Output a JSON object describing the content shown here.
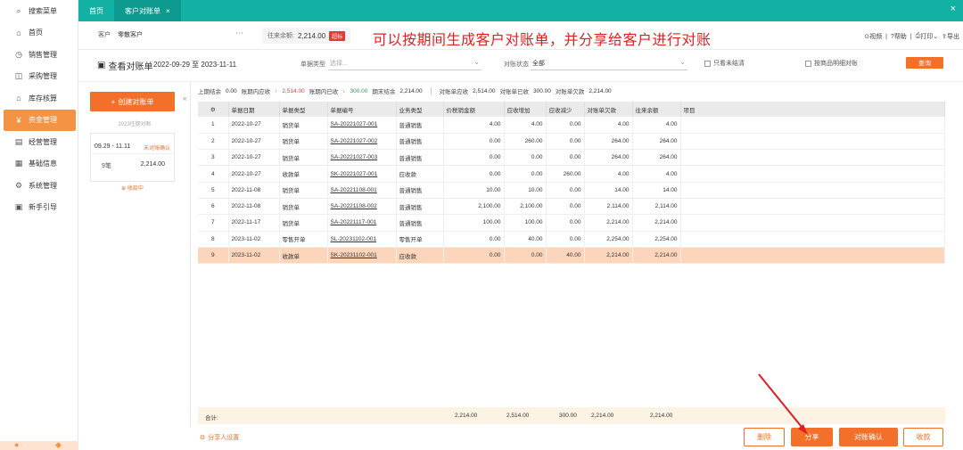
{
  "sidebar": {
    "items": [
      {
        "label": "搜索菜单",
        "icon": "search-icon"
      },
      {
        "label": "首页",
        "icon": "home-icon"
      },
      {
        "label": "销售管理",
        "icon": "sales-icon"
      },
      {
        "label": "采购管理",
        "icon": "purchase-icon"
      },
      {
        "label": "库存核算",
        "icon": "warehouse-icon"
      },
      {
        "label": "资金管理",
        "icon": "funds-icon",
        "active": true
      },
      {
        "label": "经营管理",
        "icon": "business-icon"
      },
      {
        "label": "基础信息",
        "icon": "info-icon"
      },
      {
        "label": "系统管理",
        "icon": "settings-icon"
      },
      {
        "label": "新手引导",
        "icon": "guide-icon"
      }
    ]
  },
  "tabs": [
    {
      "label": "首页"
    },
    {
      "label": "客户对账单",
      "active": true
    }
  ],
  "customer": {
    "label": "客户",
    "name": "零散客户",
    "balance_label": "往来余额:",
    "balance": "2,214.00",
    "balance_badge": "超标"
  },
  "annotation": "可以按期间生成客户对账单，并分享给客户进行对账",
  "toolbar": {
    "video": "视频",
    "help": "帮助",
    "print": "打印",
    "export": "导出"
  },
  "filter": {
    "title": "查看对账单",
    "date_range": "2022-09-29 至 2023-11-11",
    "doc_type_label": "单据类型",
    "doc_type_placeholder": "选择...",
    "status_label": "对账状态",
    "status_value": "全部",
    "only_unsettled": "只看未结清",
    "by_product": "按商品明细对账",
    "query": "查询"
  },
  "left_panel": {
    "create_label": "创建对账单",
    "subtitle": "2023往期对账",
    "card": {
      "period": "09.29 - 11.11",
      "status": "未对账确认",
      "count": "9笔",
      "amount": "2,214.00",
      "collapse": "收款中"
    }
  },
  "summary": {
    "prev_label": "上期结余",
    "prev_value": "0.00",
    "recv_label": "账期内应收",
    "recv_value": "2,514.00",
    "paid_label": "账期内已收",
    "paid_value": "300.00",
    "end_label": "期末结余",
    "end_value": "2,214.00",
    "bill_recv_label": "对账单应收",
    "bill_recv_value": "2,514.00",
    "bill_paid_label": "对账单已收",
    "bill_paid_value": "300.00",
    "bill_owe_label": "对账单欠款",
    "bill_owe_value": "2,214.00"
  },
  "table": {
    "columns": [
      "",
      "单据日期",
      "单据类型",
      "单据编号",
      "业务类型",
      "价税销金额",
      "应收增加",
      "应收减少",
      "对账单欠款",
      "往来余额",
      "项目"
    ],
    "rows": [
      [
        "1",
        "2022-10-27",
        "销货单",
        "SA-20221027-001",
        "普通销售",
        "4.00",
        "4.00",
        "0.00",
        "4.00",
        "4.00",
        ""
      ],
      [
        "2",
        "2022-10-27",
        "销货单",
        "SA-20221027-002",
        "普通销售",
        "0.00",
        "260.00",
        "0.00",
        "264.00",
        "264.00",
        ""
      ],
      [
        "3",
        "2022-10-27",
        "销货单",
        "SA-20221027-003",
        "普通销售",
        "0.00",
        "0.00",
        "0.00",
        "264.00",
        "264.00",
        ""
      ],
      [
        "4",
        "2022-10-27",
        "收款单",
        "SK-20221027-001",
        "应收款",
        "0.00",
        "0.00",
        "260.00",
        "4.00",
        "4.00",
        ""
      ],
      [
        "5",
        "2022-11-08",
        "销货单",
        "SA-20221108-001",
        "普通销售",
        "10.00",
        "10.00",
        "0.00",
        "14.00",
        "14.00",
        ""
      ],
      [
        "6",
        "2022-11-08",
        "销货单",
        "SA-20221108-002",
        "普通销售",
        "2,100.00",
        "2,100.00",
        "0.00",
        "2,114.00",
        "2,114.00",
        ""
      ],
      [
        "7",
        "2022-11-17",
        "销货单",
        "SA-20221117-001",
        "普通销售",
        "100.00",
        "100.00",
        "0.00",
        "2,214.00",
        "2,214.00",
        ""
      ],
      [
        "8",
        "2023-11-02",
        "零售开单",
        "SL-20231102-001",
        "零售开单",
        "0.00",
        "40.00",
        "0.00",
        "2,254.00",
        "2,254.00",
        ""
      ],
      [
        "9",
        "2023-11-02",
        "收款单",
        "SK-20231102-001",
        "应收款",
        "0.00",
        "0.00",
        "40.00",
        "2,214.00",
        "2,214.00",
        ""
      ]
    ],
    "totals": {
      "label": "合计:",
      "sales": "2,214.00",
      "recv_inc": "2,514.00",
      "recv_dec": "300.00",
      "owe": "2,214.00",
      "balance": "2,214.00"
    }
  },
  "bottom": {
    "share_settings": "分享人设置",
    "delete": "删除",
    "share": "分享",
    "confirm": "对账确认",
    "collect": "收款"
  },
  "colors": {
    "accent": "#f3702b",
    "teal": "#13b0a4",
    "highlight_row": "#fcd5bd",
    "annotation": "#e02020"
  }
}
